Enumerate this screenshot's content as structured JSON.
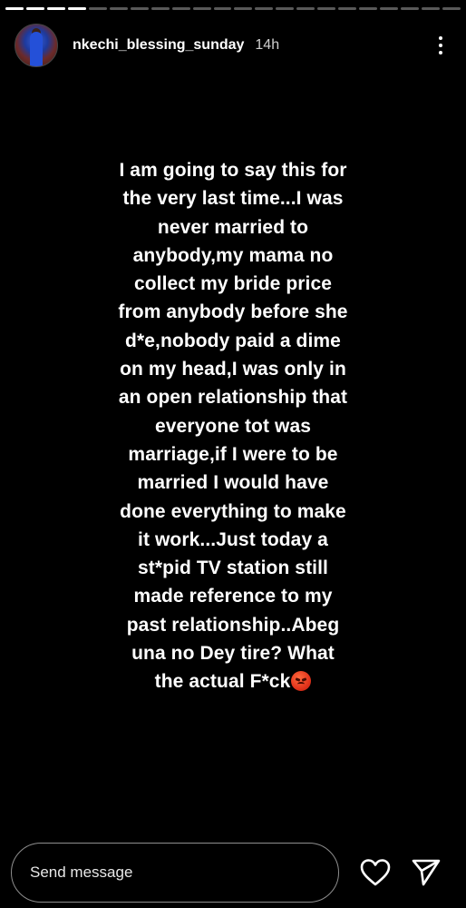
{
  "story": {
    "segment_count": 22,
    "active_segment": 4,
    "active_segment_progress": 0.0
  },
  "header": {
    "username": "nkechi_blessing_sunday",
    "timestamp": "14h",
    "avatar_icon": "profile-avatar",
    "more_icon": "more-vertical-icon"
  },
  "content": {
    "lines": [
      "I am going to say this for",
      "the very last time...I was",
      "never married to",
      "anybody,my mama no",
      "collect my bride price",
      "from anybody before she",
      "d*e,nobody paid a dime",
      "on my head,I was only in",
      "an open relationship that",
      "everyone tot was",
      "marriage,if I were to be",
      "married I would have",
      "done everything to make",
      "it work...Just today a",
      "st*pid TV station still",
      "made reference to my",
      "past relationship..Abeg",
      "una no Dey tire? What",
      "the actual F*ck"
    ],
    "trailing_emoji": "angry-face-emoji",
    "text_color": "#ffffff",
    "background_color": "#000000"
  },
  "reply": {
    "placeholder": "Send message",
    "heart_icon": "heart-icon",
    "share_icon": "send-icon"
  }
}
